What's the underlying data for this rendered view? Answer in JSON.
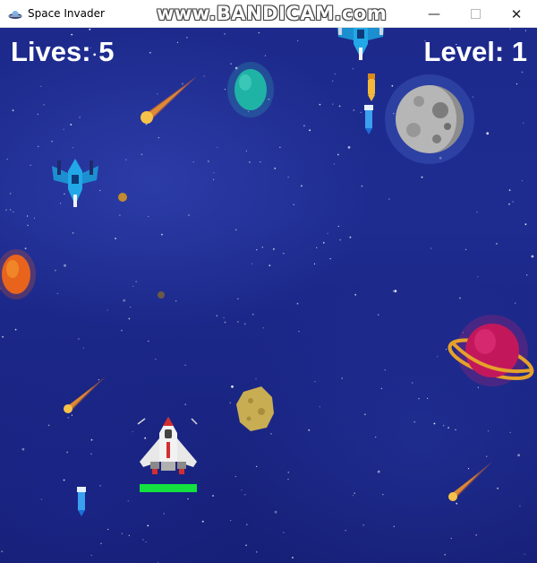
{
  "window": {
    "title": "Space Invader",
    "watermark": "www.BANDICAM.com",
    "minimize_glyph": "—",
    "close_glyph": "✕"
  },
  "hud": {
    "lives_text": "Lives: 5",
    "level_text": "Level: 1"
  },
  "player": {
    "health_fraction": 1.0,
    "health_color": "#14e040"
  },
  "colors": {
    "space_background": "#1d2a8c",
    "hud_text": "#ffffff"
  },
  "icons": [
    "app-ufo-icon",
    "minimize-icon",
    "maximize-icon",
    "close-icon",
    "player-spaceship",
    "enemy-fighter",
    "laser-bullet",
    "moon",
    "ringed-planet",
    "asteroid",
    "comet"
  ]
}
